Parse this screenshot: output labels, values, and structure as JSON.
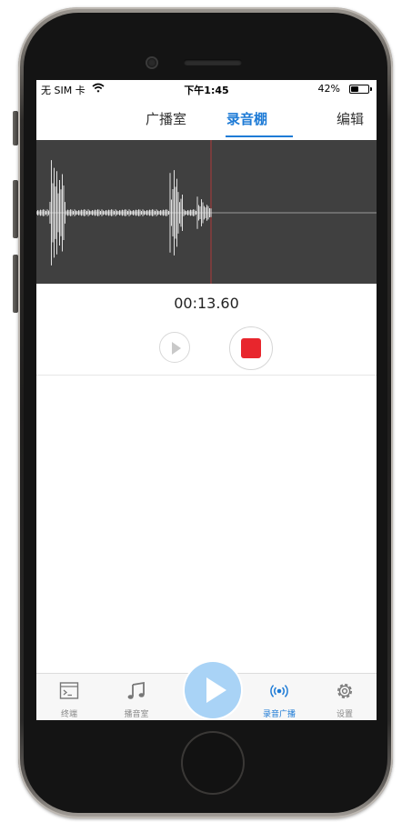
{
  "status_bar": {
    "carrier": "无 SIM 卡",
    "time": "下午1:45",
    "battery": "42%",
    "battery_level": 0.42
  },
  "nav": {
    "tabs": [
      "广播室",
      "录音棚"
    ],
    "active_tab": "录音棚",
    "edit_label": "编辑"
  },
  "recorder": {
    "elapsed": "00:13.60"
  },
  "tab_bar": {
    "items": [
      {
        "label": "终端",
        "icon": "terminal-icon"
      },
      {
        "label": "播音室",
        "icon": "music-note-icon"
      },
      {
        "label": "录音广播",
        "icon": "broadcast-icon"
      },
      {
        "label": "设置",
        "icon": "gear-icon"
      }
    ],
    "active": "录音广播",
    "center_icon": "play-icon"
  },
  "colors": {
    "accent": "#1e7bd6",
    "record": "#e8262d",
    "waveform_bg": "#404040",
    "center_button": "#a9d3f6"
  }
}
